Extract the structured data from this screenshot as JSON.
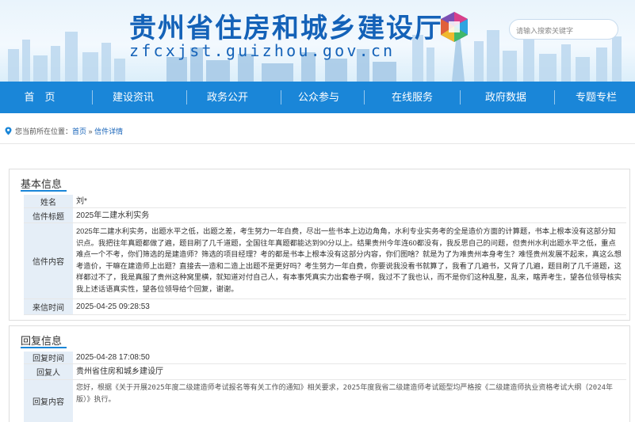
{
  "header": {
    "site_title": "贵州省住房和城乡建设厅",
    "site_domain": "zfcxjst.guizhou.gov.cn",
    "search_placeholder": "请输入搜索关键字",
    "colors": {
      "brand": "#1462b8",
      "nav": "#1a86d8"
    }
  },
  "nav": {
    "items": [
      {
        "label": "首　页"
      },
      {
        "label": "建设资讯"
      },
      {
        "label": "政务公开"
      },
      {
        "label": "公众参与"
      },
      {
        "label": "在线服务"
      },
      {
        "label": "政府数据"
      },
      {
        "label": "专题专栏"
      }
    ]
  },
  "breadcrumb": {
    "prefix": "您当前所在位置：",
    "home": "首页",
    "separator": "»",
    "current": "信件详情"
  },
  "basic_info": {
    "section_title": "基本信息",
    "name_label": "姓名",
    "name_value": "刘*",
    "subject_label": "信件标题",
    "subject_value": "2025年二建水利实务",
    "content_label": "信件内容",
    "content_value": "2025年二建水利实务，出题水平之低，出题之差，考生努力一年白费，尽出一些书本上边边角角，水利专业实务考的全是造价方面的计算题，书本上根本没有这部分知识点。我把往年真题都做了遍，题目刷了几千道题，全国往年真题都能达到90分以上。结果贵州今年连60都没有，我反思自己的问题，但贵州水利出题水平之低，重点难点一个不考，你们筛选的是建造师？筛选的项目经理？考的都是书本上根本没有这部分内容，你们图啥？就是为了为难贵州本身考生？难怪贵州发展不起来，真这么想考造价，干嘛在建造师上出题？直接去一造和二造上出题不是更好吗？考生努力一年白费，你要说我没看书就算了，我看了几遍书，又背了几遍，题目刷了几千道题，这样都过不了，我是真服了贵州这种窝里横，就知道对付自己人，有本事凭真实力出套卷子啊，我过不了我也认，而不是你们这种乱整，乱来，瞎弄考生，望各位领导核实我上述话语真实性，望各位领导给个回复，谢谢。",
    "time_label": "来信时间",
    "time_value": "2025-04-25 09:28:53"
  },
  "reply_info": {
    "section_title": "回复信息",
    "time_label": "回复时间",
    "time_value": "2025-04-28 17:08:50",
    "replier_label": "回复人",
    "replier_value": "贵州省住房和城乡建设厅",
    "content_label": "回复内容",
    "content_value": "您好，根据《关于开展2025年度二级建造师考试报名等有关工作的通知》相关要求，2025年度我省二级建造师考试题型均严格按《二级建造师执业资格考试大纲（2024年版）》执行。"
  }
}
